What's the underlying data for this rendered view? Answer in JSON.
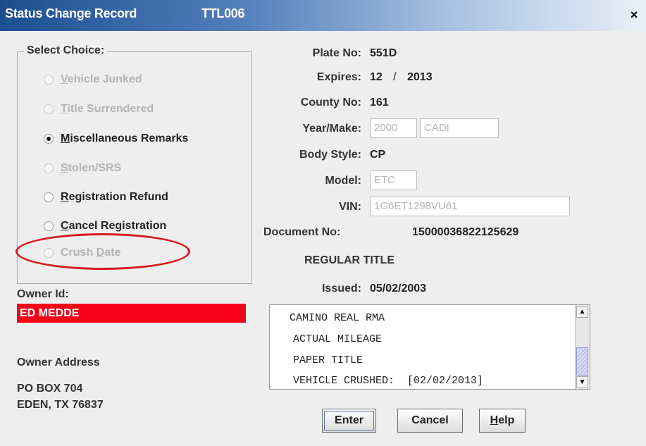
{
  "window": {
    "title": "Status Change Record",
    "code": "TTL006",
    "close_label": "×"
  },
  "choices": {
    "legend": "Select Choice:",
    "items": [
      {
        "mnemonic": "V",
        "rest": "ehicle Junked",
        "enabled": false,
        "checked": false
      },
      {
        "mnemonic": "T",
        "rest": "itle Surrendered",
        "enabled": false,
        "checked": false
      },
      {
        "mnemonic": "M",
        "rest": "iscellaneous Remarks",
        "enabled": true,
        "checked": true
      },
      {
        "mnemonic": "S",
        "rest": "tolen/SRS",
        "enabled": false,
        "checked": false
      },
      {
        "mnemonic": "R",
        "rest": "egistration Refund",
        "enabled": true,
        "checked": false
      },
      {
        "mnemonic": "C",
        "rest": "ancel Registration",
        "enabled": true,
        "checked": false
      },
      {
        "prefix": "Crush ",
        "mnemonic": "D",
        "rest": "ate",
        "enabled": false,
        "checked": false
      }
    ]
  },
  "vehicle": {
    "plate_label": "Plate No:",
    "plate": "551D",
    "expires_label": "Expires:",
    "expires_month": "12",
    "expires_sep": "/",
    "expires_year": "2013",
    "county_label": "County No:",
    "county": "161",
    "yearmake_label": "Year/Make:",
    "year": "2000",
    "make": "CADI",
    "bodystyle_label": "Body Style:",
    "bodystyle": "CP",
    "model_label": "Model:",
    "model": "ETC",
    "vin_label": "VIN:",
    "vin": "1G6ET1298VU61",
    "document_label": "Document No:",
    "document": "15000036822125629",
    "title_type": "REGULAR TITLE",
    "issued_label": "Issued:",
    "issued": "05/02/2003"
  },
  "owner": {
    "id_label": "Owner Id:",
    "id_value": "ED MEDDE",
    "address_label": "Owner Address",
    "address_line1": "PO BOX 704",
    "address_line2": "EDEN, TX 76837"
  },
  "remarks": [
    "  CAMINO REAL RMA",
    "ACTUAL MILEAGE",
    "PAPER TITLE",
    "VEHICLE CRUSHED:  [02/02/2013]"
  ],
  "buttons": {
    "enter": "Enter",
    "cancel": "Cancel",
    "help_mnemonic": "H",
    "help_rest": "elp"
  },
  "colors": {
    "owner_highlight": "#f80018",
    "annotation": "#d7191c",
    "title_bar": "#1c4e8f"
  }
}
